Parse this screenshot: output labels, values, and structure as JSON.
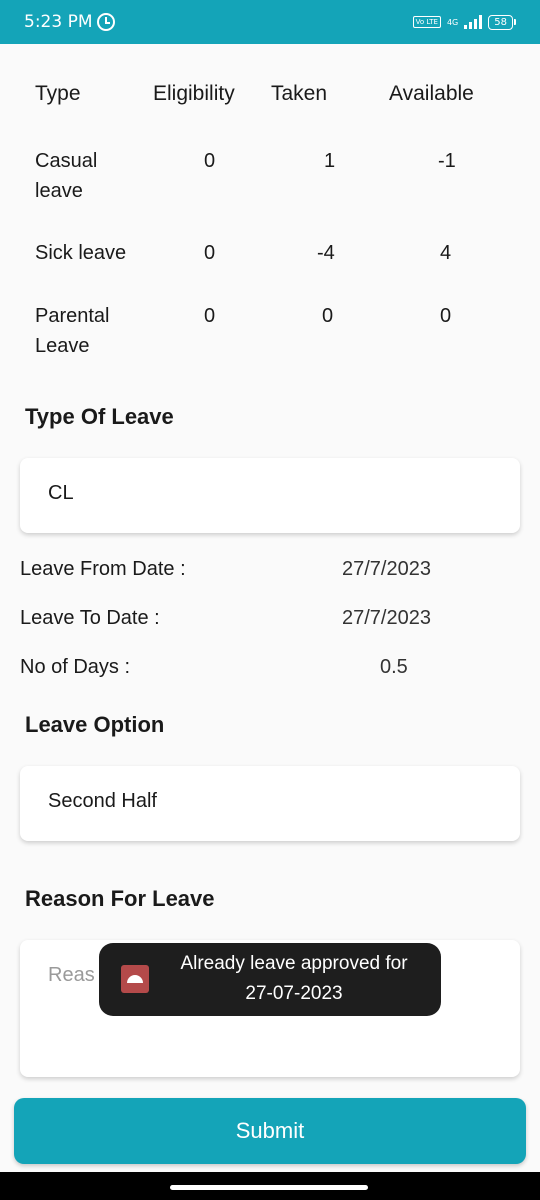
{
  "status_bar": {
    "time": "5:23 PM",
    "volte": "Vo LTE",
    "network": "4G",
    "battery": "58",
    "icons": [
      "alarm-icon",
      "signal-icon",
      "battery-icon"
    ]
  },
  "leave_table": {
    "headers": [
      "Type",
      "Eligibility",
      "Taken",
      "Available"
    ],
    "rows": [
      {
        "type_line1": "Casual",
        "type_line2": "leave",
        "eligibility": "0",
        "taken": "1",
        "available": "-1"
      },
      {
        "type_line1": "Sick leave",
        "type_line2": "",
        "eligibility": "0",
        "taken": "-4",
        "available": "4"
      },
      {
        "type_line1": "Parental",
        "type_line2": "Leave",
        "eligibility": "0",
        "taken": "0",
        "available": "0"
      }
    ]
  },
  "type_of_leave": {
    "title": "Type Of Leave",
    "value": "CL"
  },
  "dates": {
    "from_label": "Leave From Date :",
    "from_value": "27/7/2023",
    "to_label": "Leave To Date :",
    "to_value": "27/7/2023",
    "days_label": "No of Days :",
    "days_value": "0.5"
  },
  "leave_option": {
    "title": "Leave Option",
    "value": "Second Half"
  },
  "reason": {
    "title": "Reason For Leave",
    "placeholder": "Reas"
  },
  "toast": {
    "line1": "Already leave approved for",
    "line2": "27-07-2023",
    "icon": "android-app-icon"
  },
  "submit_label": "Submit",
  "colors": {
    "accent": "#14a4b8",
    "toast_bg": "#1e1e1e",
    "page_bg": "#fafafa"
  }
}
